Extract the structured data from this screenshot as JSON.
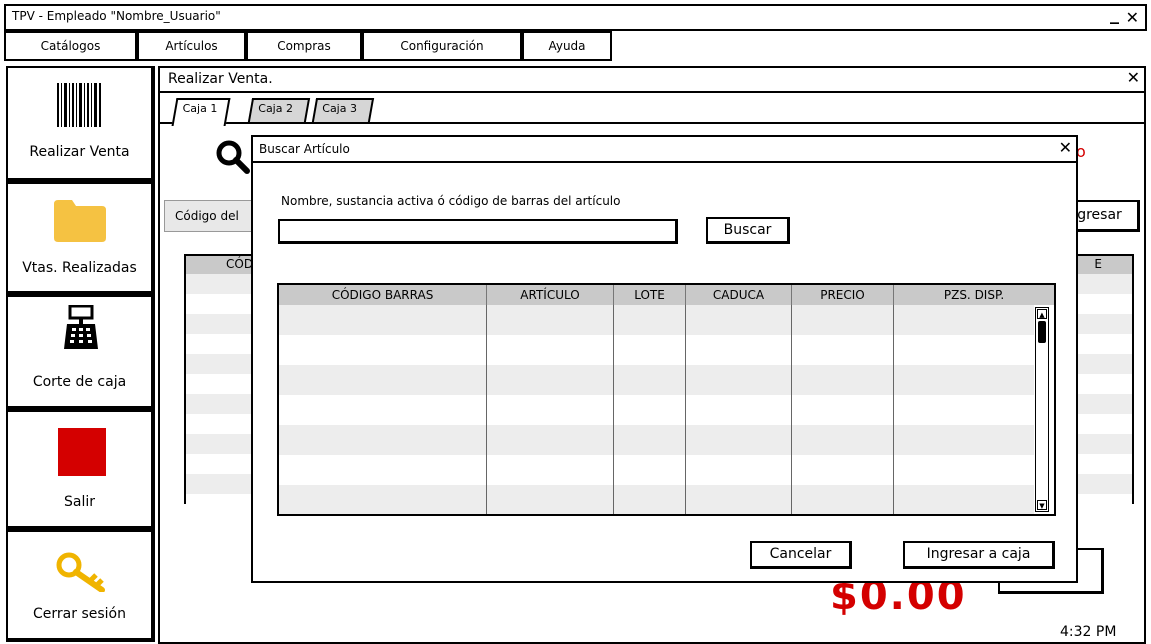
{
  "app": {
    "title": "TPV - Empleado \"Nombre_Usuario\"",
    "minimize": "_",
    "close": "✕"
  },
  "menu": [
    "Catálogos",
    "Artículos",
    "Compras",
    "Configuración",
    "Ayuda"
  ],
  "sidebar": [
    {
      "label": "Realizar Venta",
      "icon": "barcode-icon"
    },
    {
      "label": "Vtas. Realizadas",
      "icon": "folder-icon"
    },
    {
      "label": "Corte de caja",
      "icon": "cash-register-icon"
    },
    {
      "label": "Salir",
      "icon": "red-square-icon"
    },
    {
      "label": "Cerrar sesión",
      "icon": "key-icon"
    }
  ],
  "main": {
    "title": "Realizar Venta.",
    "close": "✕",
    "tabs": [
      "Caja 1",
      "Caja 2",
      "Caja 3"
    ],
    "code_label_partial": "Código del",
    "ingresar_partial": "gresar",
    "header_partial_left": "CÓD",
    "header_partial_right": "E",
    "red_dot": "o",
    "total_partial": "$0.00"
  },
  "modal": {
    "title": "Buscar Artículo",
    "close": "✕",
    "search_label": "Nombre, sustancia activa ó código de barras del artículo",
    "search_value": "",
    "search_button": "Buscar",
    "columns": [
      "CÓDIGO BARRAS",
      "ARTÍCULO",
      "LOTE",
      "CADUCA",
      "PRECIO",
      "PZS. DISP."
    ],
    "cancel_button": "Cancelar",
    "ingresar_button": "Ingresar a caja"
  },
  "status": {
    "time": "4:32 PM"
  },
  "colors": {
    "accent_red": "#d40000",
    "folder": "#f5c242",
    "key": "#f0b400",
    "header_gray": "#c9c9c9",
    "stripe": "#ededed"
  }
}
